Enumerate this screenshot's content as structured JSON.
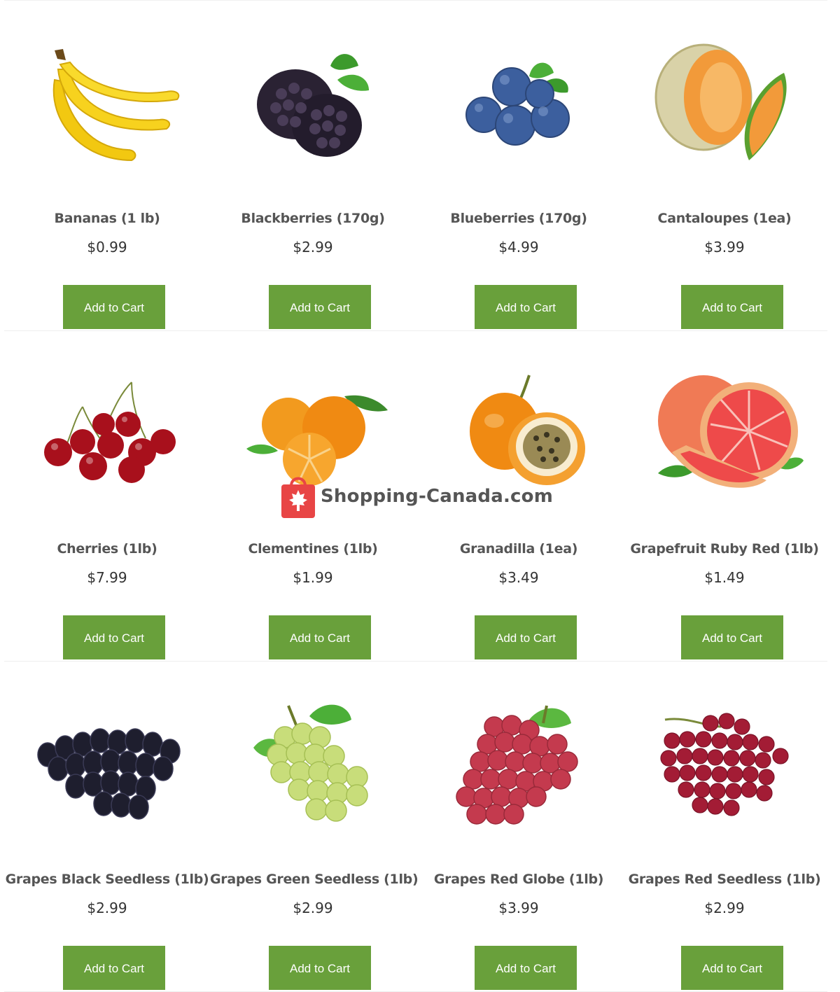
{
  "products": [
    {
      "name": "Bananas (1 lb)",
      "price": "$0.99",
      "button": "Add to Cart",
      "icon": "banana-image"
    },
    {
      "name": "Blackberries (170g)",
      "price": "$2.99",
      "button": "Add to Cart",
      "icon": "blackberry-image"
    },
    {
      "name": "Blueberries (170g)",
      "price": "$4.99",
      "button": "Add to Cart",
      "icon": "blueberry-image"
    },
    {
      "name": "Cantaloupes (1ea)",
      "price": "$3.99",
      "button": "Add to Cart",
      "icon": "cantaloupe-image"
    },
    {
      "name": "Cherries (1lb)",
      "price": "$7.99",
      "button": "Add to Cart",
      "icon": "cherry-image"
    },
    {
      "name": "Clementines (1lb)",
      "price": "$1.99",
      "button": "Add to Cart",
      "icon": "clementine-image"
    },
    {
      "name": "Granadilla (1ea)",
      "price": "$3.49",
      "button": "Add to Cart",
      "icon": "granadilla-image"
    },
    {
      "name": "Grapefruit Ruby Red (1lb)",
      "price": "$1.49",
      "button": "Add to Cart",
      "icon": "grapefruit-image"
    },
    {
      "name": "Grapes Black Seedless (1lb)",
      "price": "$2.99",
      "button": "Add to Cart",
      "icon": "black-grapes-image"
    },
    {
      "name": "Grapes Green Seedless (1lb)",
      "price": "$2.99",
      "button": "Add to Cart",
      "icon": "green-grapes-image"
    },
    {
      "name": "Grapes Red Globe (1lb)",
      "price": "$3.99",
      "button": "Add to Cart",
      "icon": "red-globe-grapes-image"
    },
    {
      "name": "Grapes Red Seedless (1lb)",
      "price": "$2.99",
      "button": "Add to Cart",
      "icon": "red-grapes-image"
    }
  ],
  "watermark": {
    "text": "Shopping-Canada.com",
    "icon": "maple-leaf-bag-icon"
  },
  "colors": {
    "button_bg": "#69a03b",
    "button_text": "#ffffff",
    "name_text": "#555555",
    "price_text": "#333333",
    "watermark_red": "#e84545"
  }
}
